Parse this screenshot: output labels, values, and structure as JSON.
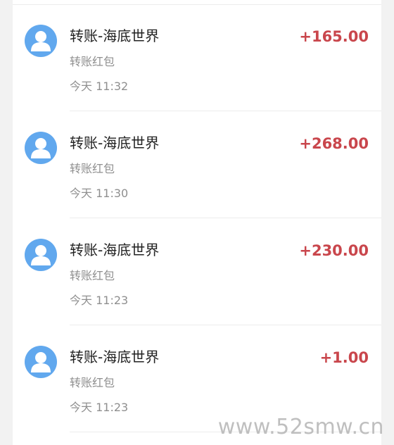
{
  "transactions": [
    {
      "title": "转账-海底世界",
      "subtitle": "转账红包",
      "time": "今天 11:32",
      "amount": "+165.00"
    },
    {
      "title": "转账-海底世界",
      "subtitle": "转账红包",
      "time": "今天 11:30",
      "amount": "+268.00"
    },
    {
      "title": "转账-海底世界",
      "subtitle": "转账红包",
      "time": "今天 11:23",
      "amount": "+230.00"
    },
    {
      "title": "转账-海底世界",
      "subtitle": "转账红包",
      "time": "今天 11:23",
      "amount": "+1.00"
    }
  ],
  "icons": {
    "avatar": "person-avatar-icon"
  },
  "colors": {
    "avatar": "#61a8ee",
    "amount": "#c9464c"
  },
  "watermark": "www.52smw.cn"
}
